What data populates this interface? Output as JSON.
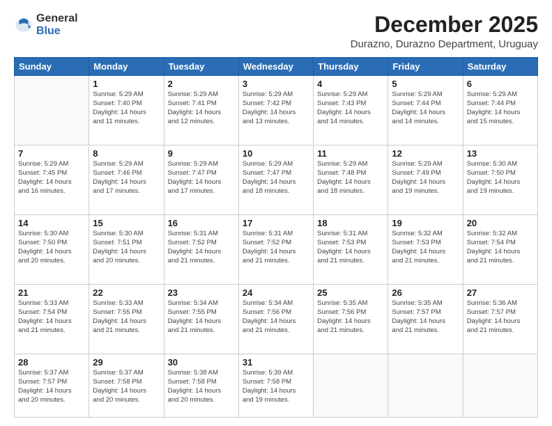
{
  "header": {
    "logo_general": "General",
    "logo_blue": "Blue",
    "month_year": "December 2025",
    "location": "Durazno, Durazno Department, Uruguay"
  },
  "days_of_week": [
    "Sunday",
    "Monday",
    "Tuesday",
    "Wednesday",
    "Thursday",
    "Friday",
    "Saturday"
  ],
  "weeks": [
    [
      {
        "day": "",
        "info": ""
      },
      {
        "day": "1",
        "info": "Sunrise: 5:29 AM\nSunset: 7:40 PM\nDaylight: 14 hours\nand 11 minutes."
      },
      {
        "day": "2",
        "info": "Sunrise: 5:29 AM\nSunset: 7:41 PM\nDaylight: 14 hours\nand 12 minutes."
      },
      {
        "day": "3",
        "info": "Sunrise: 5:29 AM\nSunset: 7:42 PM\nDaylight: 14 hours\nand 13 minutes."
      },
      {
        "day": "4",
        "info": "Sunrise: 5:29 AM\nSunset: 7:43 PM\nDaylight: 14 hours\nand 14 minutes."
      },
      {
        "day": "5",
        "info": "Sunrise: 5:29 AM\nSunset: 7:44 PM\nDaylight: 14 hours\nand 14 minutes."
      },
      {
        "day": "6",
        "info": "Sunrise: 5:29 AM\nSunset: 7:44 PM\nDaylight: 14 hours\nand 15 minutes."
      }
    ],
    [
      {
        "day": "7",
        "info": "Sunrise: 5:29 AM\nSunset: 7:45 PM\nDaylight: 14 hours\nand 16 minutes."
      },
      {
        "day": "8",
        "info": "Sunrise: 5:29 AM\nSunset: 7:46 PM\nDaylight: 14 hours\nand 17 minutes."
      },
      {
        "day": "9",
        "info": "Sunrise: 5:29 AM\nSunset: 7:47 PM\nDaylight: 14 hours\nand 17 minutes."
      },
      {
        "day": "10",
        "info": "Sunrise: 5:29 AM\nSunset: 7:47 PM\nDaylight: 14 hours\nand 18 minutes."
      },
      {
        "day": "11",
        "info": "Sunrise: 5:29 AM\nSunset: 7:48 PM\nDaylight: 14 hours\nand 18 minutes."
      },
      {
        "day": "12",
        "info": "Sunrise: 5:29 AM\nSunset: 7:49 PM\nDaylight: 14 hours\nand 19 minutes."
      },
      {
        "day": "13",
        "info": "Sunrise: 5:30 AM\nSunset: 7:50 PM\nDaylight: 14 hours\nand 19 minutes."
      }
    ],
    [
      {
        "day": "14",
        "info": "Sunrise: 5:30 AM\nSunset: 7:50 PM\nDaylight: 14 hours\nand 20 minutes."
      },
      {
        "day": "15",
        "info": "Sunrise: 5:30 AM\nSunset: 7:51 PM\nDaylight: 14 hours\nand 20 minutes."
      },
      {
        "day": "16",
        "info": "Sunrise: 5:31 AM\nSunset: 7:52 PM\nDaylight: 14 hours\nand 21 minutes."
      },
      {
        "day": "17",
        "info": "Sunrise: 5:31 AM\nSunset: 7:52 PM\nDaylight: 14 hours\nand 21 minutes."
      },
      {
        "day": "18",
        "info": "Sunrise: 5:31 AM\nSunset: 7:53 PM\nDaylight: 14 hours\nand 21 minutes."
      },
      {
        "day": "19",
        "info": "Sunrise: 5:32 AM\nSunset: 7:53 PM\nDaylight: 14 hours\nand 21 minutes."
      },
      {
        "day": "20",
        "info": "Sunrise: 5:32 AM\nSunset: 7:54 PM\nDaylight: 14 hours\nand 21 minutes."
      }
    ],
    [
      {
        "day": "21",
        "info": "Sunrise: 5:33 AM\nSunset: 7:54 PM\nDaylight: 14 hours\nand 21 minutes."
      },
      {
        "day": "22",
        "info": "Sunrise: 5:33 AM\nSunset: 7:55 PM\nDaylight: 14 hours\nand 21 minutes."
      },
      {
        "day": "23",
        "info": "Sunrise: 5:34 AM\nSunset: 7:55 PM\nDaylight: 14 hours\nand 21 minutes."
      },
      {
        "day": "24",
        "info": "Sunrise: 5:34 AM\nSunset: 7:56 PM\nDaylight: 14 hours\nand 21 minutes."
      },
      {
        "day": "25",
        "info": "Sunrise: 5:35 AM\nSunset: 7:56 PM\nDaylight: 14 hours\nand 21 minutes."
      },
      {
        "day": "26",
        "info": "Sunrise: 5:35 AM\nSunset: 7:57 PM\nDaylight: 14 hours\nand 21 minutes."
      },
      {
        "day": "27",
        "info": "Sunrise: 5:36 AM\nSunset: 7:57 PM\nDaylight: 14 hours\nand 21 minutes."
      }
    ],
    [
      {
        "day": "28",
        "info": "Sunrise: 5:37 AM\nSunset: 7:57 PM\nDaylight: 14 hours\nand 20 minutes."
      },
      {
        "day": "29",
        "info": "Sunrise: 5:37 AM\nSunset: 7:58 PM\nDaylight: 14 hours\nand 20 minutes."
      },
      {
        "day": "30",
        "info": "Sunrise: 5:38 AM\nSunset: 7:58 PM\nDaylight: 14 hours\nand 20 minutes."
      },
      {
        "day": "31",
        "info": "Sunrise: 5:39 AM\nSunset: 7:58 PM\nDaylight: 14 hours\nand 19 minutes."
      },
      {
        "day": "",
        "info": ""
      },
      {
        "day": "",
        "info": ""
      },
      {
        "day": "",
        "info": ""
      }
    ]
  ]
}
